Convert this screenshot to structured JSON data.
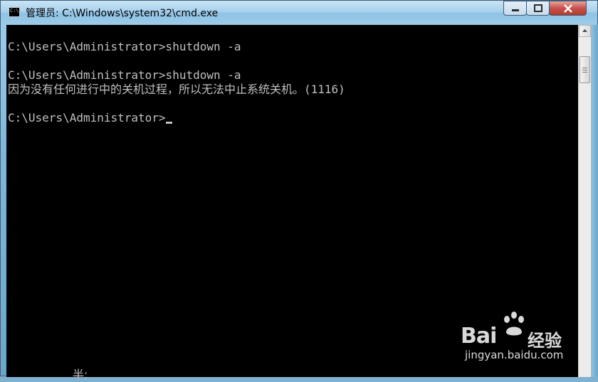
{
  "window": {
    "title": "管理员: C:\\Windows\\system32\\cmd.exe",
    "icon_label": "C:\\.",
    "controls": {
      "minimize_icon": "minimize-icon",
      "maximize_icon": "maximize-icon",
      "close_icon": "close-icon"
    }
  },
  "console": {
    "lines": [
      "C:\\Users\\Administrator>shutdown -a",
      "",
      "C:\\Users\\Administrator>shutdown -a",
      "因为没有任何进行中的关机过程，所以无法中止系统关机。(1116)",
      "",
      "C:\\Users\\Administrator>"
    ],
    "bottom_fragment": "半:"
  },
  "watermark": {
    "brand": "Bai",
    "brand_suffix": "经验",
    "url": "jingyan.baidu.com"
  },
  "colors": {
    "console_bg": "#000000",
    "console_fg": "#c0c0c0",
    "titlebar": "#a9d2ec",
    "close_button": "#c75050"
  }
}
